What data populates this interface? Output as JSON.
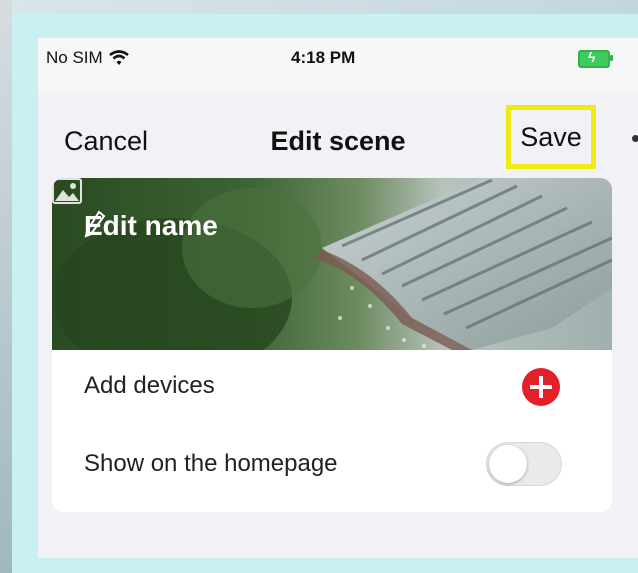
{
  "status_bar": {
    "carrier": "No SIM",
    "time": "4:18 PM",
    "wifi_icon": "wifi-icon",
    "battery_icon": "battery-charging-icon"
  },
  "nav": {
    "cancel_label": "Cancel",
    "title": "Edit scene",
    "save_label": "Save"
  },
  "banner": {
    "name_label": "Edit name",
    "edit_icon": "pencil-icon",
    "change_image_icon": "image-icon"
  },
  "rows": {
    "add_devices_label": "Add devices",
    "add_icon": "plus-icon",
    "show_homepage_label": "Show on the homepage",
    "show_homepage_enabled": false
  },
  "colors": {
    "highlight": "#f2ea15",
    "add_button": "#e3202a",
    "battery": "#3fcb5b"
  }
}
